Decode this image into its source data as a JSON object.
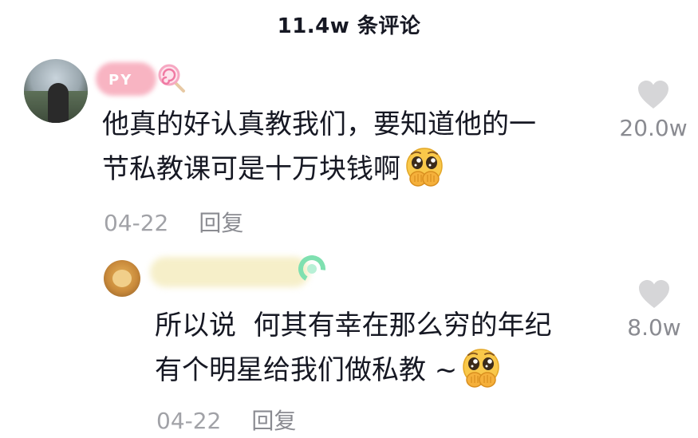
{
  "header": {
    "title": "11.4w 条评论"
  },
  "comments": [
    {
      "username_visible": "PY",
      "username_emoji": "lollipop",
      "text_lines": [
        "他真的好认真教我们，要知道他的一",
        "节私教课可是十万块钱啊"
      ],
      "trailing_emoji": "pleading-face-covering-mouth",
      "date": "04-22",
      "reply_label": "回复",
      "like_count": "20.0w",
      "like_icon": "heart-icon",
      "avatar_icon": "avatar"
    },
    {
      "username_visible": "",
      "username_emoji": "green-badge",
      "text_lines": [
        "所以说  何其有幸在那么穷的年纪",
        "有个明星给我们做私教 ~"
      ],
      "trailing_emoji": "pleading-face-covering-mouth",
      "date": "04-22",
      "reply_label": "回复",
      "like_count": "8.0w",
      "like_icon": "heart-icon",
      "avatar_icon": "avatar"
    }
  ],
  "colors": {
    "text_primary": "#161823",
    "text_secondary": "#a1a2a7",
    "heart": "#d6d6d8",
    "emoji_face": "#f9c84a",
    "emoji_hands": "#f5b03b",
    "blur_pink": "#f7a7b8",
    "blur_cream": "#f6efc9"
  }
}
